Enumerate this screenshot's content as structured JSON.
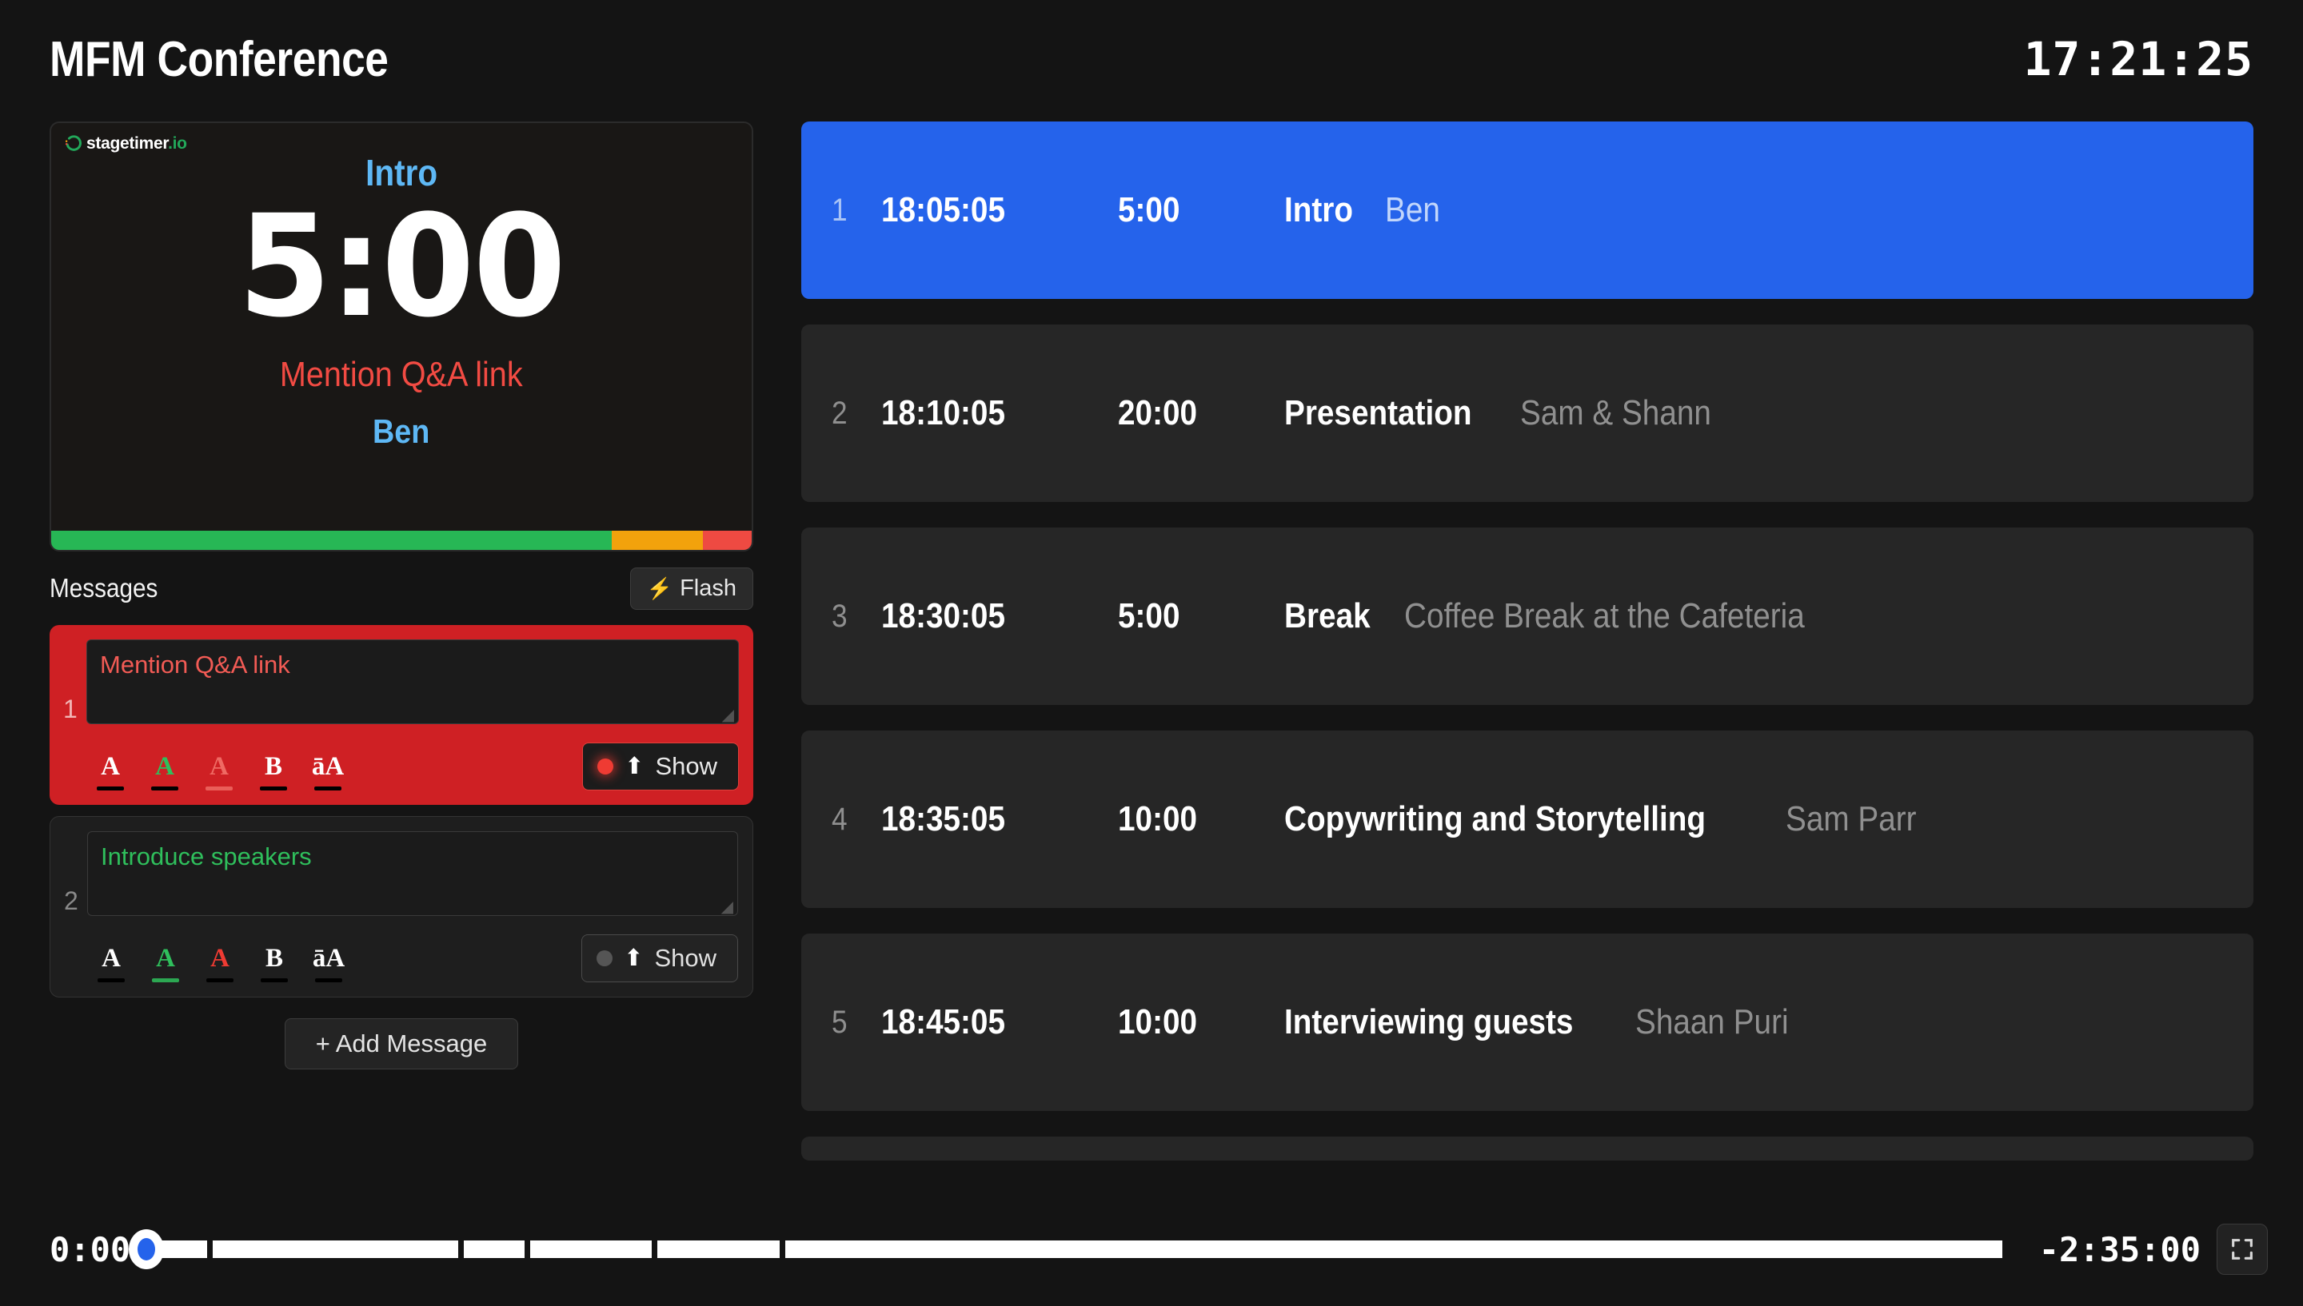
{
  "header": {
    "room_title": "MFM Conference",
    "clock": "17:21:25"
  },
  "preview": {
    "logo_name": "stagetimer",
    "logo_tld": ".io",
    "title": "Intro",
    "time": "5:00",
    "message": "Mention Q&A link",
    "speaker": "Ben",
    "progress": {
      "green_pct": 80,
      "orange_pct": 13,
      "red_pct": 7,
      "green_color": "#27b755",
      "orange_color": "#f2a20c",
      "red_color": "#ee4a42"
    }
  },
  "messages": {
    "heading": "Messages",
    "flash_label": "Flash",
    "flash_icon": "bolt-icon",
    "add_label": "+ Add Message",
    "items": [
      {
        "index": "1",
        "text": "Mention Q&A link",
        "color": "#f25b55",
        "active": true,
        "show_label": "Show",
        "format_buttons": [
          {
            "glyph": "A",
            "name": "text-color-white",
            "color": "#ffffff",
            "selected": false
          },
          {
            "glyph": "A",
            "name": "text-color-green",
            "color": "#2fbf5c",
            "selected": false
          },
          {
            "glyph": "A",
            "name": "text-color-red",
            "color": "#ef6a63",
            "selected": true
          },
          {
            "glyph": "B",
            "name": "bold-toggle",
            "color": "#ffffff",
            "selected": false
          },
          {
            "glyph": "āA",
            "name": "uppercase-toggle",
            "color": "#ffffff",
            "selected": false
          }
        ]
      },
      {
        "index": "2",
        "text": "Introduce speakers",
        "color": "#2fbf5c",
        "active": false,
        "show_label": "Show",
        "format_buttons": [
          {
            "glyph": "A",
            "name": "text-color-white",
            "color": "#ffffff",
            "selected": false
          },
          {
            "glyph": "A",
            "name": "text-color-green",
            "color": "#2fbf5c",
            "selected": true
          },
          {
            "glyph": "A",
            "name": "text-color-red",
            "color": "#ef3b33",
            "selected": false
          },
          {
            "glyph": "B",
            "name": "bold-toggle",
            "color": "#ffffff",
            "selected": false
          },
          {
            "glyph": "āA",
            "name": "uppercase-toggle",
            "color": "#ffffff",
            "selected": false
          }
        ]
      }
    ]
  },
  "schedule": {
    "active_color": "#2563eb",
    "rows": [
      {
        "index": "1",
        "start": "18:05:05",
        "duration": "5:00",
        "name": "Intro",
        "speaker": "Ben",
        "active": true
      },
      {
        "index": "2",
        "start": "18:10:05",
        "duration": "20:00",
        "name": "Presentation",
        "speaker": "Sam & Shann",
        "active": false
      },
      {
        "index": "3",
        "start": "18:30:05",
        "duration": "5:00",
        "name": "Break",
        "speaker": "Coffee Break at the Cafeteria",
        "active": false
      },
      {
        "index": "4",
        "start": "18:35:05",
        "duration": "10:00",
        "name": "Copywriting and Storytelling",
        "speaker": "Sam Parr",
        "active": false
      },
      {
        "index": "5",
        "start": "18:45:05",
        "duration": "10:00",
        "name": "Interviewing guests",
        "speaker": "Shaan Puri",
        "active": false
      }
    ]
  },
  "bottom": {
    "elapsed": "0:00",
    "remaining": "-2:35:00",
    "scrub_position_pct": 0,
    "fullscreen_icon": "fullscreen-icon",
    "track_segments": [
      3.2,
      12.9,
      3.2,
      6.4,
      6.4,
      64.0
    ]
  }
}
